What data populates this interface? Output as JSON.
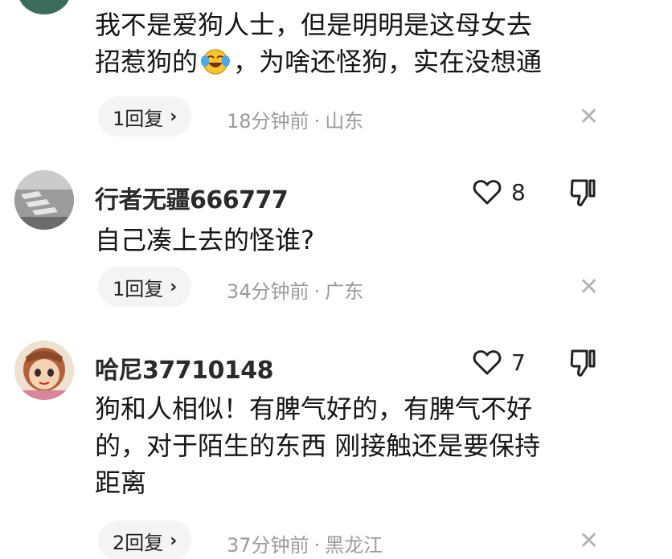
{
  "comments": [
    {
      "text_lines": [
        "我不是爱狗人士，但是明明是这母女去",
        "招惹狗的",
        "，为啥还怪狗，实在没想通"
      ],
      "replies_label": "1回复",
      "time": "18分钟前",
      "location": "山东"
    },
    {
      "username": "行者无疆666777",
      "likes": "8",
      "text_lines": [
        "自己凑上去的怪谁?"
      ],
      "replies_label": "1回复",
      "time": "34分钟前",
      "location": "广东"
    },
    {
      "username": "哈尼37710148",
      "likes": "7",
      "text_lines": [
        "狗和人相似！有脾气好的，有脾气不好",
        "的，对于陌生的东西 刚接触还是要保持",
        "距离"
      ],
      "replies_label": "2回复",
      "time": "37分钟前",
      "location": "黑龙江"
    }
  ],
  "icons": {
    "chevron": "chevron-right-icon",
    "close": "close-icon",
    "like": "heart-outline-icon",
    "dislike": "thumb-down-icon",
    "emoji": "laughing-crying-emoji"
  },
  "glyphs": {
    "chevron": "›",
    "close": "✕",
    "dot": "·"
  }
}
